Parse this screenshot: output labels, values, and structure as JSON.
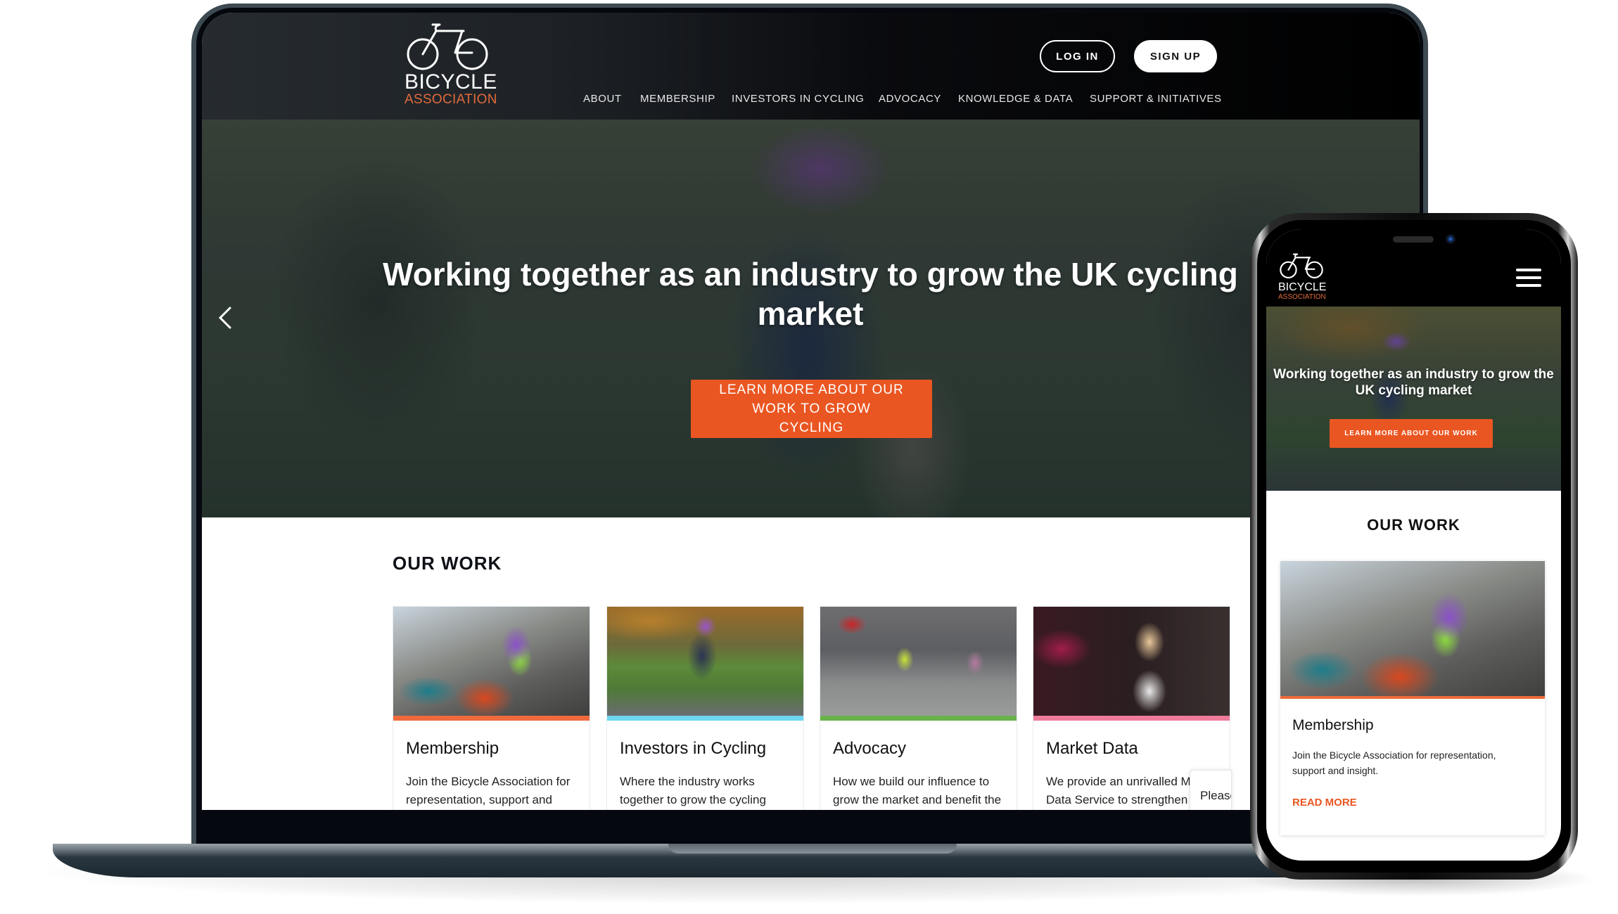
{
  "brand": {
    "name_line1": "BICYCLE",
    "name_line2": "ASSOCIATION",
    "accent_color": "#ea5622",
    "logo_icon": "bicycle-icon"
  },
  "header": {
    "login_label": "LOG IN",
    "signup_label": "SIGN UP",
    "nav": [
      {
        "label": "ABOUT"
      },
      {
        "label": "MEMBERSHIP"
      },
      {
        "label": "INVESTORS IN CYCLING"
      },
      {
        "label": "ADVOCACY"
      },
      {
        "label": "KNOWLEDGE & DATA"
      },
      {
        "label": "SUPPORT & INITIATIVES"
      }
    ]
  },
  "hero": {
    "title": "Working together as an industry to grow the UK cycling market",
    "cta_label": "LEARN MORE ABOUT OUR WORK TO GROW CYCLING",
    "prev_icon": "chevron-left-icon"
  },
  "our_work": {
    "title": "OUR WORK",
    "cards": [
      {
        "title": "Membership",
        "description": "Join the Bicycle Association for representation, support and insight.",
        "bar_color": "#f06a3c"
      },
      {
        "title": "Investors in Cycling",
        "description": "Where the industry works together to grow the cycling market.",
        "bar_color": "#6fd6f2"
      },
      {
        "title": "Advocacy",
        "description": "How we build our influence to grow the market and benefit the entire cycling community.",
        "bar_color": "#68b34b"
      },
      {
        "title": "Market Data",
        "description": "We provide an unrivalled Market Data Service to strengthen and inform the",
        "bar_color": "#ef7b9a"
      }
    ]
  },
  "toast": {
    "text": "Please"
  },
  "mobile": {
    "hero_title": "Working together as an industry to grow the UK cycling market",
    "hero_cta": "LEARN MORE ABOUT OUR WORK",
    "our_work_title": "OUR WORK",
    "card": {
      "title": "Membership",
      "description": "Join the Bicycle Association for representation, support and insight.",
      "link_label": "READ MORE"
    },
    "menu_icon": "hamburger-menu-icon"
  }
}
